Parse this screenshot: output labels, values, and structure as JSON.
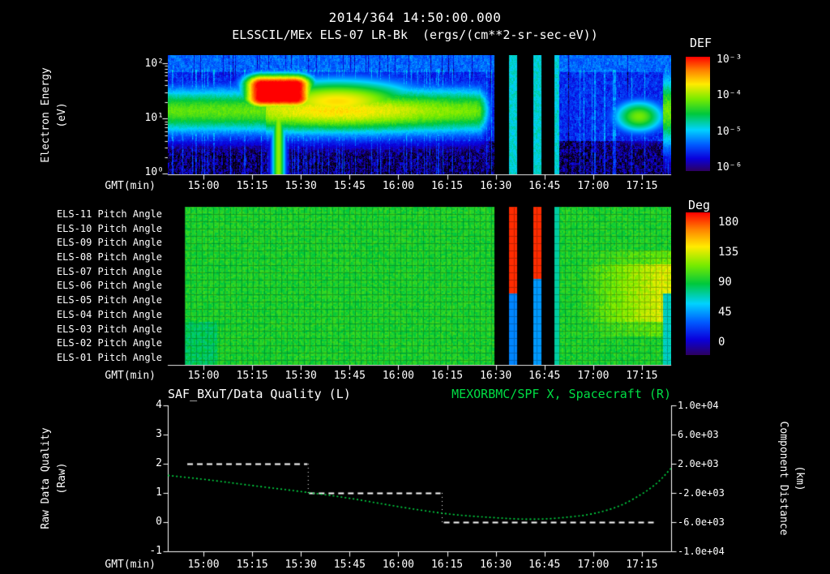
{
  "header": {
    "timestamp": "2014/364 14:50:00.000",
    "instrument": "ELSSCIL/MEx ELS-07 LR-Bk",
    "units": "(ergs/(cm**2-sr-sec-eV))"
  },
  "colors": {
    "background": "#000000",
    "text": "#ffffff",
    "accent_green": "#00dd44"
  },
  "xaxis": {
    "label": "GMT(min)",
    "start": "14:49",
    "end": "17:24",
    "ticks": [
      "15:00",
      "15:15",
      "15:30",
      "15:45",
      "16:00",
      "16:15",
      "16:30",
      "16:45",
      "17:00",
      "17:15"
    ],
    "tick_t_min": [
      11,
      26,
      41,
      56,
      71,
      86,
      101,
      116,
      131,
      146
    ]
  },
  "spectrogram_panel": {
    "ylabel": "Electron Energy",
    "ylabel_units": "(eV)",
    "yticks": [
      "10²",
      "10¹",
      "10⁰"
    ],
    "colorbar": {
      "title": "DEF",
      "ticks": [
        "10⁻³",
        "10⁻⁴",
        "10⁻⁵",
        "10⁻⁶"
      ]
    }
  },
  "pitch_panel": {
    "row_labels": [
      "ELS-11 Pitch Angle",
      "ELS-10 Pitch Angle",
      "ELS-09 Pitch Angle",
      "ELS-08 Pitch Angle",
      "ELS-07 Pitch Angle",
      "ELS-06 Pitch Angle",
      "ELS-05 Pitch Angle",
      "ELS-04 Pitch Angle",
      "ELS-03 Pitch Angle",
      "ELS-02 Pitch Angle",
      "ELS-01 Pitch Angle"
    ],
    "colorbar": {
      "title": "Deg",
      "ticks": [
        "180",
        "135",
        "90",
        "45",
        "0"
      ]
    }
  },
  "timeseries_panel": {
    "left_title": "SAF_BXuT/Data Quality (L)",
    "right_title": "MEXORBMC/SPF X, Spacecraft (R)",
    "left_ylabel": "Raw Data Quality",
    "left_ylabel_units": "(Raw)",
    "left_yticks": [
      "4",
      "3",
      "2",
      "1",
      "0",
      "-1"
    ],
    "right_ylabel": "Component Distance",
    "right_ylabel_units": "(km)",
    "right_yticks": [
      "1.0e+04",
      "6.0e+03",
      "2.0e+03",
      "-2.0e+03",
      "-6.0e+03",
      "-1.0e+04"
    ]
  },
  "chart_data": [
    {
      "id": "electron_energy_spectrogram",
      "type": "heatmap",
      "title": "ELSSCIL/MEx ELS-07 LR-Bk",
      "x_axis": {
        "label": "GMT(min)",
        "start": "14:49",
        "end": "17:24"
      },
      "y_axis": {
        "label": "Electron Energy (eV)",
        "scale": "log",
        "min": 1,
        "max": 140
      },
      "z_axis": {
        "label": "DEF (ergs/(cm**2-sr-sec-eV))",
        "scale": "log",
        "min": 1e-06,
        "max": 0.001
      },
      "t_reference": "t_min values are minutes after 14:49 GMT",
      "features": [
        "intense burst ~15:18-15:35 at 20-60 eV peaking near 1e-3 (red core, orange/yellow halo)",
        "warm yellow-green ridge 15:30-16:10 near 15-30 eV (~1e-4)",
        "persistent 10-30 eV green band (~5e-5) from start until ~16:25",
        "weak blue speckle background (~3e-6) elsewhere; darkest below ~4 eV",
        "bright blue full-height columns between data gaps",
        "dim region 16:50-17:05, then bright green patch 17:05-17:20 near 10 eV",
        "bright column at right edge ~17:23"
      ],
      "data_gaps_gmt": [
        [
          "16:30",
          "16:34"
        ],
        [
          "16:37",
          "16:42"
        ],
        [
          "16:44",
          "16:48"
        ]
      ],
      "gaps_min": [
        [
          100.5,
          105
        ],
        [
          107.5,
          112.5
        ],
        [
          115,
          119
        ]
      ],
      "bright_columns_min": [
        [
          105,
          107.5
        ],
        [
          112.5,
          115
        ],
        [
          119,
          120.5
        ]
      ],
      "burst_center_min": 34
    },
    {
      "id": "pitch_angle_panels",
      "type": "heatmap",
      "rows": [
        "ELS-11",
        "ELS-10",
        "ELS-09",
        "ELS-08",
        "ELS-07",
        "ELS-06",
        "ELS-05",
        "ELS-04",
        "ELS-03",
        "ELS-02",
        "ELS-01"
      ],
      "z_axis": {
        "label": "Pitch Angle (Deg)",
        "min": 0,
        "max": 180
      },
      "typical_deg": 95,
      "data_start_min": 5,
      "gaps_min": [
        [
          100.5,
          105
        ],
        [
          107.5,
          112.5
        ],
        [
          115,
          119
        ]
      ],
      "features": [
        "near-uniform ~90-100 deg (green) on all anodes with fine grid texture",
        "red (~175 deg) stripes on upper anodes and blue (~50 deg) on lower anodes flanking the 16:30-16:48 gaps",
        "ELS-04 to ELS-07 drift toward ~125-130 deg (yellow) after ~17:00",
        "data begins ~14:54"
      ]
    },
    {
      "id": "quality_and_spacecraft_x",
      "type": "line",
      "t_reference": "t_min values are minutes after 14:49 GMT",
      "left_axis": {
        "label": "Raw Data Quality (Raw)",
        "min": -1,
        "max": 4,
        "ticks": [
          4,
          3,
          2,
          1,
          0,
          -1
        ]
      },
      "right_axis": {
        "label": "Component Distance (km)",
        "min": -10000,
        "max": 10000,
        "ticks": [
          10000,
          6000,
          2000,
          -2000,
          -6000,
          -10000
        ]
      },
      "series": [
        {
          "name": "SAF_BXuT/Data Quality (L)",
          "axis": "left",
          "style": "white dashed step",
          "segments": [
            {
              "t_min": [
                6,
                43
              ],
              "value": 2
            },
            {
              "t_min": [
                43.5,
                84
              ],
              "value": 1
            },
            {
              "t_min": [
                85,
                150.5
              ],
              "value": 0
            }
          ]
        },
        {
          "name": "MEXORBMC/SPF X, Spacecraft (R)",
          "axis": "right",
          "style": "green dotted",
          "units": "km",
          "t_min": [
            0,
            11,
            26,
            41,
            56,
            71,
            86,
            94,
            101,
            108,
            116,
            124,
            131,
            139,
            146,
            151,
            155
          ],
          "km": [
            400,
            -100,
            -1000,
            -1800,
            -2700,
            -3900,
            -4900,
            -5200,
            -5400,
            -5600,
            -5600,
            -5300,
            -4900,
            -3900,
            -2200,
            -600,
            1400
          ]
        }
      ]
    }
  ]
}
